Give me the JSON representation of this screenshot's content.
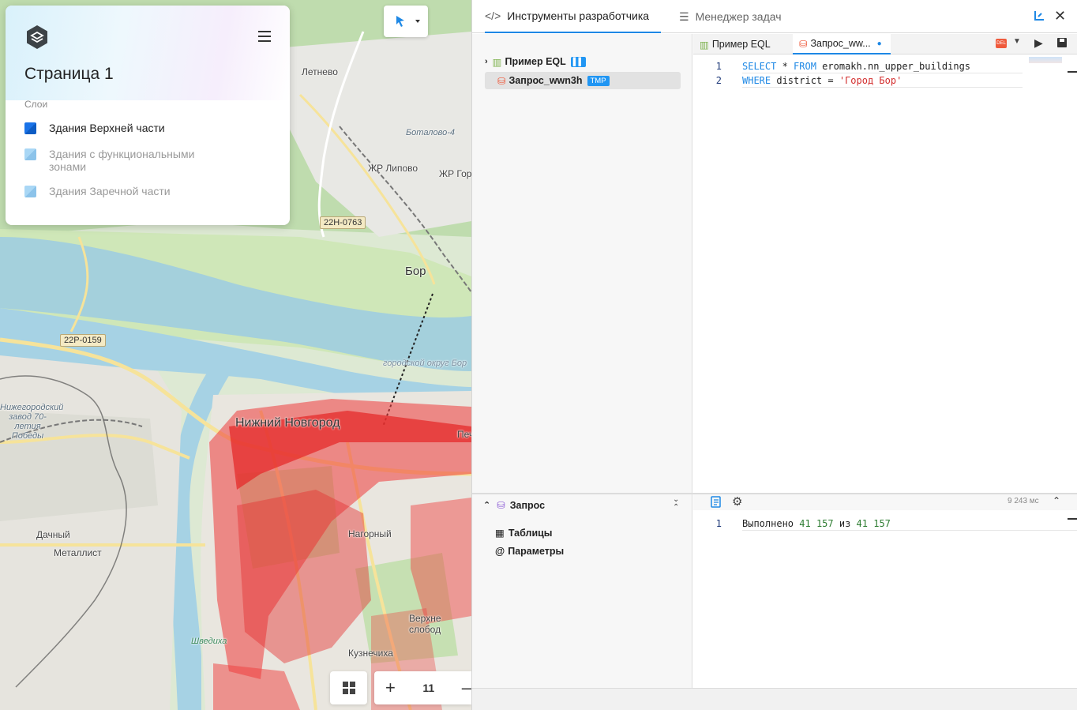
{
  "map": {
    "labels": {
      "letnevo": "Летнево",
      "botalovo": "Боталово-4",
      "zhr_lipovo": "ЖР Липово",
      "zhr_gor": "ЖР Гор",
      "bor": "Бор",
      "bor_district": "городской округ Бор",
      "nizhny": "Нижний Новгород",
      "factory": "Нижегородский завод 70-летия Победы",
      "dachny": "Дачный",
      "metallist": "Металлист",
      "shvedikha": "Шведиха",
      "kuznechikha": "Кузнечиха",
      "verkhnyaya": "Верхне слобод",
      "nagornaya": "Нагорный",
      "pechery": "Печер"
    },
    "road_shields": {
      "r1": "22Н-0763",
      "r2": "22Р-0159"
    },
    "zoom_level": "11"
  },
  "layer_panel": {
    "page_title": "Страница 1",
    "layers_label": "Слои",
    "layers": [
      {
        "name": "Здания Верхней части",
        "color": "#1a73e8",
        "active": true
      },
      {
        "name": "Здания с функциональными зонами",
        "color": "#90c8f0",
        "active": false
      },
      {
        "name": "Здания Заречной части",
        "color": "#90c8f0",
        "active": false
      }
    ]
  },
  "devtools": {
    "tabs": {
      "dev": "Инструменты разработчика",
      "tasks": "Менеджер задач"
    },
    "tree": {
      "item1": "Пример EQL",
      "item2": "Запрос_wwn3h",
      "item2_tag": "TMP"
    },
    "editor_tabs": {
      "tab1": "Пример EQL",
      "tab2": "Запрос_ww..."
    },
    "code": {
      "ln1": "1",
      "ln2": "2",
      "l1_kw1": "SELECT",
      "l1_star": " * ",
      "l1_kw2": "FROM",
      "l1_tbl": " eromakh.nn_upper_buildings",
      "l2_kw": "WHERE",
      "l2_id": " district = ",
      "l2_str": "'Город Бор'"
    },
    "nav": {
      "query": "Запрос",
      "tables": "Таблицы",
      "params": "Параметры"
    },
    "result": {
      "time": "9 243 мс",
      "ln": "1",
      "done": "Выполнено",
      "n1": "41 157",
      "of": "из",
      "n2": "41 157"
    },
    "colors": {
      "accent": "#1e88e5",
      "string": "#d32f2f",
      "number": "#2e7d32"
    }
  }
}
